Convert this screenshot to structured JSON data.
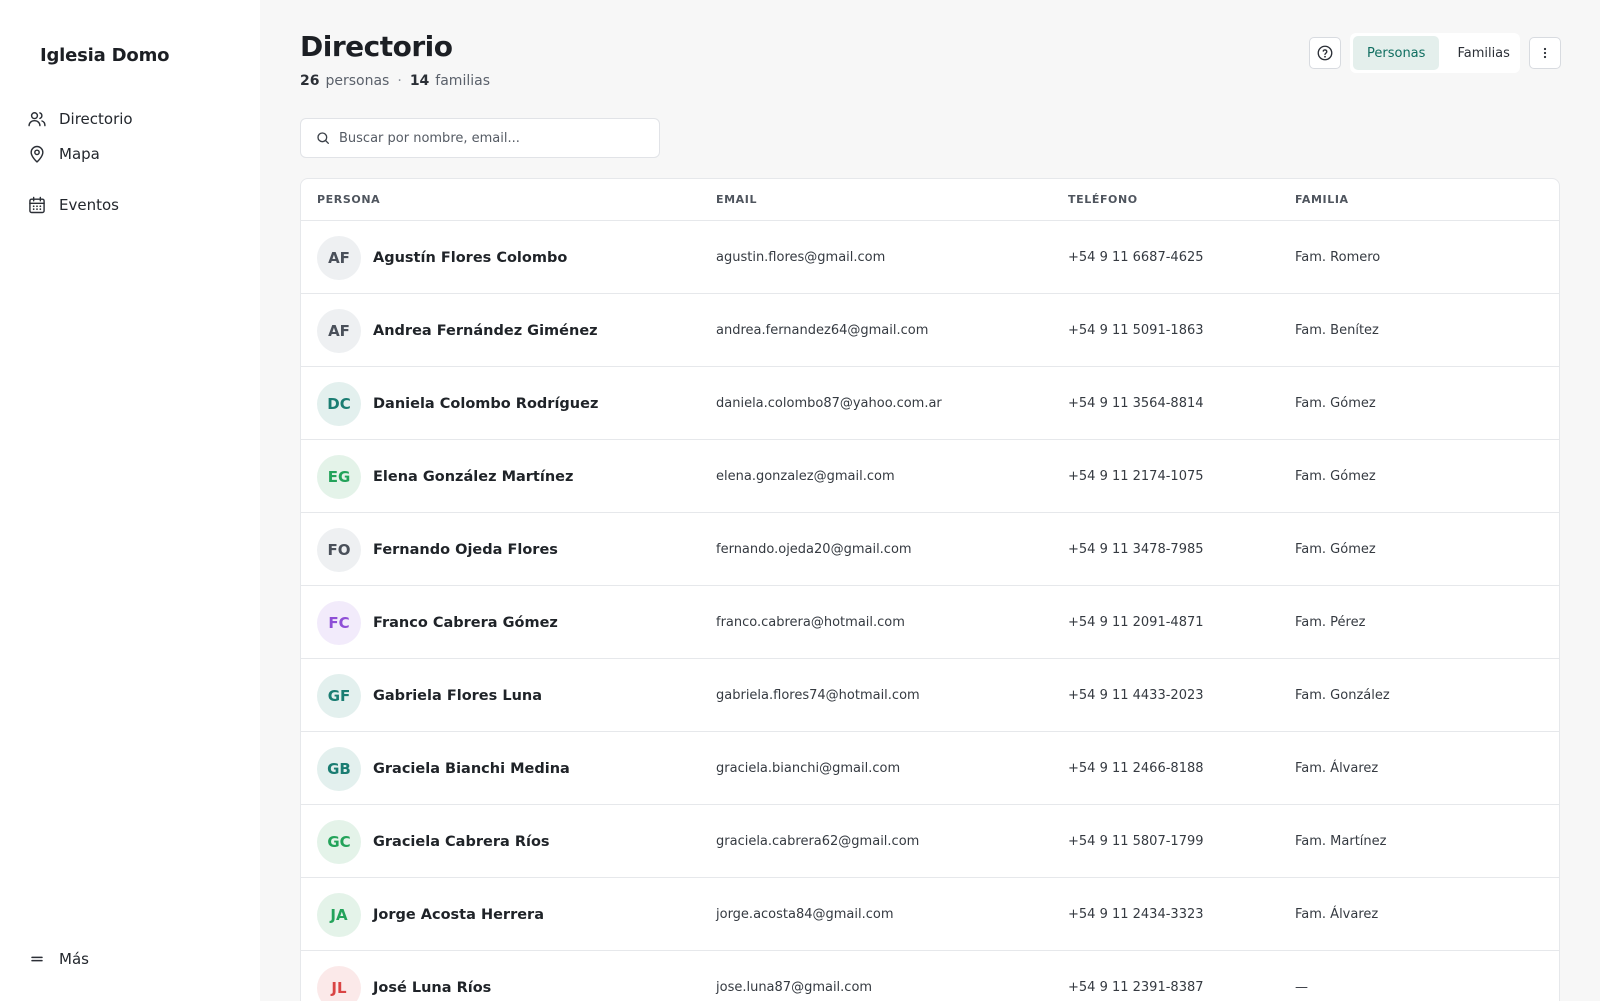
{
  "app": {
    "brand": "Iglesia Domo"
  },
  "sidebar": {
    "items": [
      {
        "label": "Directorio",
        "icon": "users-icon"
      },
      {
        "label": "Mapa",
        "icon": "map-pin-icon"
      },
      {
        "label": "Eventos",
        "icon": "calendar-icon"
      }
    ],
    "more": {
      "label": "Más",
      "icon": "menu-lines-icon"
    }
  },
  "header": {
    "title": "Directorio",
    "people_count": "26",
    "people_label": "personas",
    "separator": "·",
    "families_count": "14",
    "families_label": "familias"
  },
  "view_toggle": {
    "options": [
      "Personas",
      "Familias"
    ],
    "selected": "Personas"
  },
  "search": {
    "placeholder": "Buscar por nombre, email..."
  },
  "table": {
    "columns": [
      "PERSONA",
      "EMAIL",
      "TELÉFONO",
      "FAMILIA"
    ],
    "rows": [
      {
        "initials": "AF",
        "name": "Agustín Flores Colombo",
        "email": "agustin.flores@gmail.com",
        "phone": "+54 9 11 6687-4625",
        "family": "Fam. Romero",
        "avatar_bg": "#eef0f2",
        "avatar_fg": "#4a505a"
      },
      {
        "initials": "AF",
        "name": "Andrea Fernández Giménez",
        "email": "andrea.fernandez64@gmail.com",
        "phone": "+54 9 11 5091-1863",
        "family": "Fam. Benítez",
        "avatar_bg": "#eef0f2",
        "avatar_fg": "#4a505a"
      },
      {
        "initials": "DC",
        "name": "Daniela Colombo Rodríguez",
        "email": "daniela.colombo87@yahoo.com.ar",
        "phone": "+54 9 11 3564-8814",
        "family": "Fam. Gómez",
        "avatar_bg": "#e3f0ee",
        "avatar_fg": "#1a7d72"
      },
      {
        "initials": "EG",
        "name": "Elena González Martínez",
        "email": "elena.gonzalez@gmail.com",
        "phone": "+54 9 11 2174-1075",
        "family": "Fam. Gómez",
        "avatar_bg": "#e4f3e9",
        "avatar_fg": "#23a35a"
      },
      {
        "initials": "FO",
        "name": "Fernando Ojeda Flores",
        "email": "fernando.ojeda20@gmail.com",
        "phone": "+54 9 11 3478-7985",
        "family": "Fam. Gómez",
        "avatar_bg": "#eef0f2",
        "avatar_fg": "#4a505a"
      },
      {
        "initials": "FC",
        "name": "Franco Cabrera Gómez",
        "email": "franco.cabrera@hotmail.com",
        "phone": "+54 9 11 2091-4871",
        "family": "Fam. Pérez",
        "avatar_bg": "#f2ebfb",
        "avatar_fg": "#8e4fd6"
      },
      {
        "initials": "GF",
        "name": "Gabriela Flores Luna",
        "email": "gabriela.flores74@hotmail.com",
        "phone": "+54 9 11 4433-2023",
        "family": "Fam. González",
        "avatar_bg": "#e3f0ee",
        "avatar_fg": "#1a7d72"
      },
      {
        "initials": "GB",
        "name": "Graciela Bianchi Medina",
        "email": "graciela.bianchi@gmail.com",
        "phone": "+54 9 11 2466-8188",
        "family": "Fam. Álvarez",
        "avatar_bg": "#e3f0ee",
        "avatar_fg": "#1a7d72"
      },
      {
        "initials": "GC",
        "name": "Graciela Cabrera Ríos",
        "email": "graciela.cabrera62@gmail.com",
        "phone": "+54 9 11 5807-1799",
        "family": "Fam. Martínez",
        "avatar_bg": "#e4f3e9",
        "avatar_fg": "#23a35a"
      },
      {
        "initials": "JA",
        "name": "Jorge Acosta Herrera",
        "email": "jorge.acosta84@gmail.com",
        "phone": "+54 9 11 2434-3323",
        "family": "Fam. Álvarez",
        "avatar_bg": "#e4f3e9",
        "avatar_fg": "#23a35a"
      },
      {
        "initials": "JL",
        "name": "José Luna Ríos",
        "email": "jose.luna87@gmail.com",
        "phone": "+54 9 11 2391-8387",
        "family": "—",
        "avatar_bg": "#fbe9e9",
        "avatar_fg": "#d94444"
      }
    ]
  }
}
